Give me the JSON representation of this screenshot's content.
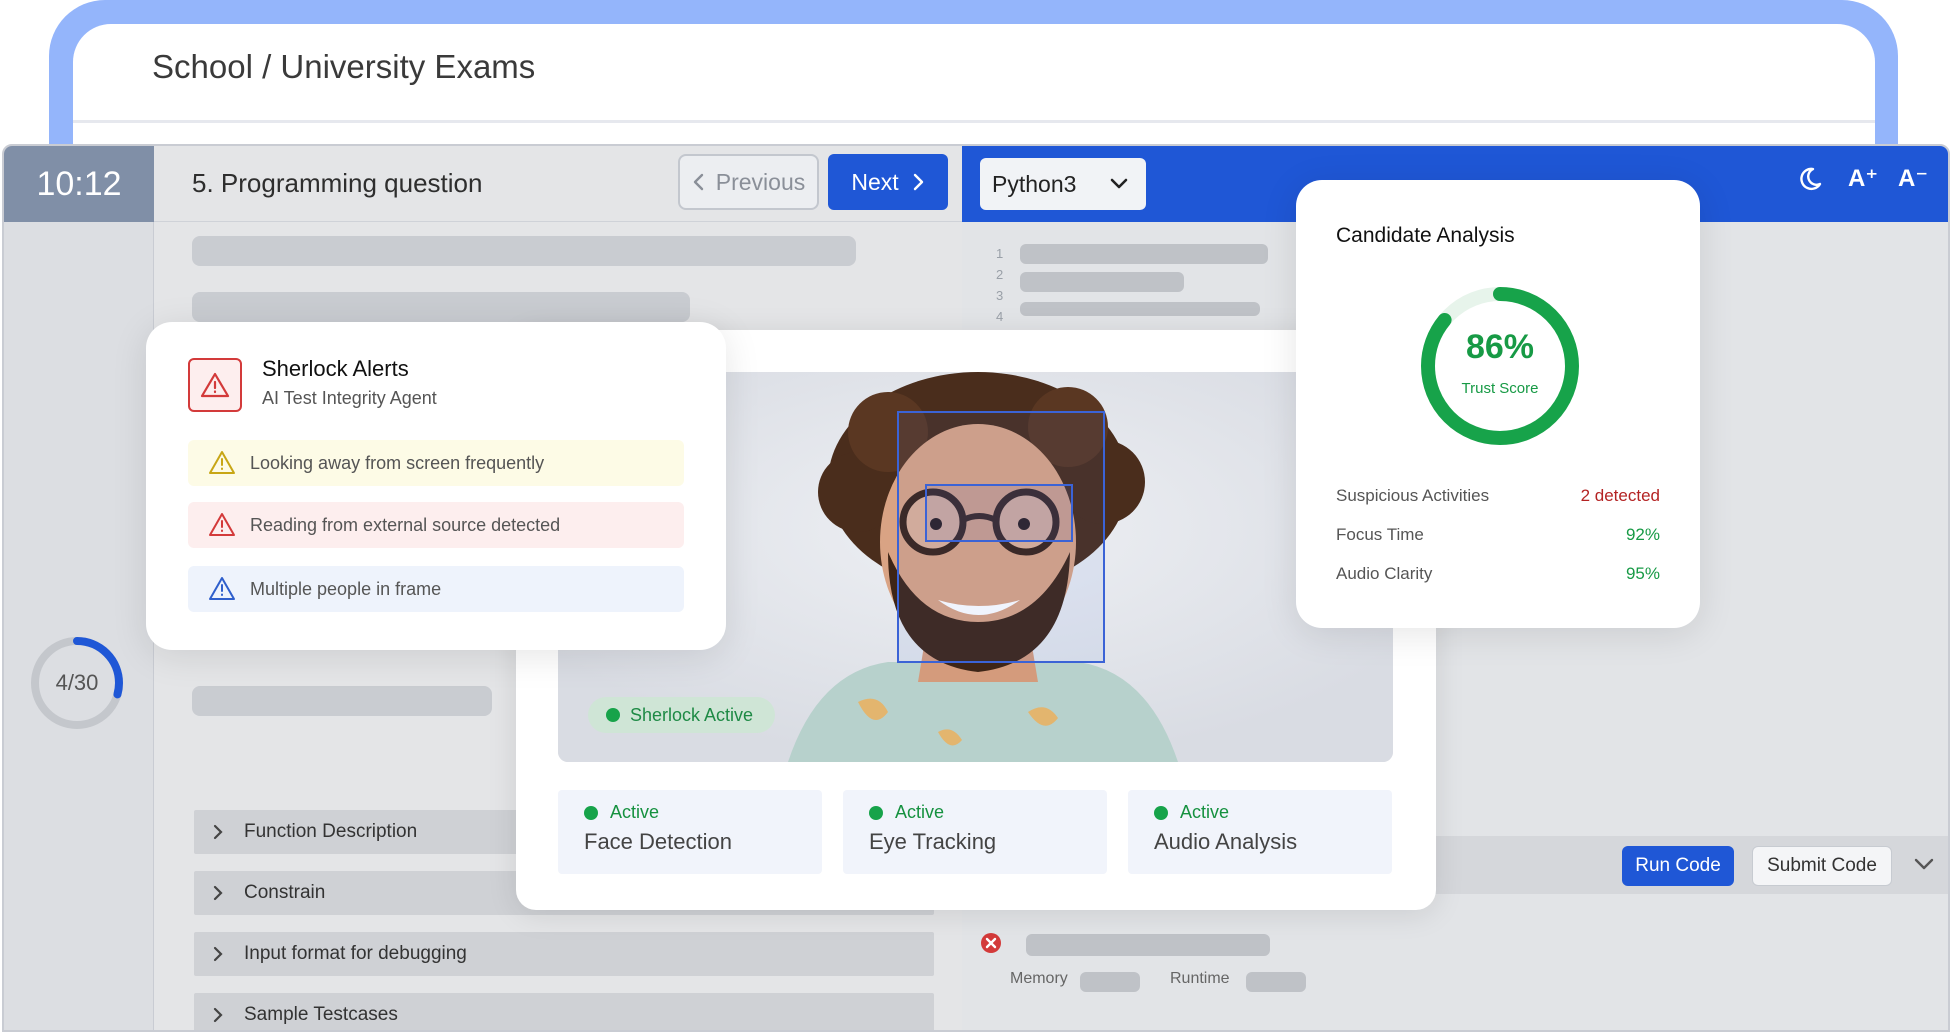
{
  "back": {
    "title": "School / University Exams"
  },
  "header": {
    "timer": "10:12",
    "question_title": "5. Programming question",
    "previous_label": "Previous",
    "next_label": "Next",
    "language": "Python3",
    "font_increase": "A⁺",
    "font_decrease": "A⁻"
  },
  "progress": {
    "label": "4/30",
    "current": 4,
    "total": 30
  },
  "editor": {
    "line_numbers": [
      "1",
      "2",
      "3",
      "4"
    ]
  },
  "accordion": [
    {
      "label": "Function Description"
    },
    {
      "label": "Constrain"
    },
    {
      "label": "Input format for debugging"
    },
    {
      "label": "Sample Testcases"
    }
  ],
  "console": {
    "run_label": "Run Code",
    "submit_label": "Submit Code",
    "memory_label": "Memory",
    "runtime_label": "Runtime"
  },
  "alerts": {
    "title": "Sherlock Alerts",
    "subtitle": "AI Test Integrity Agent",
    "items": [
      {
        "text": "Looking away from screen frequently",
        "bg": "#fdfbe6",
        "icon_color": "#c8a615"
      },
      {
        "text": "Reading from external source detected",
        "bg": "#fdeeee",
        "icon_color": "#d33a3a"
      },
      {
        "text": "Multiple people in frame",
        "bg": "#eef3fc",
        "icon_color": "#2f5fcc"
      }
    ]
  },
  "video": {
    "pill": "Sherlock Active",
    "features": [
      {
        "status": "Active",
        "name": "Face Detection"
      },
      {
        "status": "Active",
        "name": "Eye Tracking"
      },
      {
        "status": "Active",
        "name": "Audio Analysis"
      }
    ]
  },
  "analysis": {
    "title": "Candidate Analysis",
    "score": "86%",
    "score_value": 86,
    "score_label": "Trust Score",
    "metrics": [
      {
        "label": "Suspicious Activities",
        "value": "2 detected",
        "color": "#b42323"
      },
      {
        "label": "Focus Time",
        "value": "92%",
        "color": "#179a45"
      },
      {
        "label": "Audio Clarity",
        "value": "95%",
        "color": "#179a45"
      }
    ]
  },
  "colors": {
    "primary": "#1f57d6",
    "success": "#179a45",
    "danger": "#d33a3a",
    "warning": "#c8a615"
  }
}
